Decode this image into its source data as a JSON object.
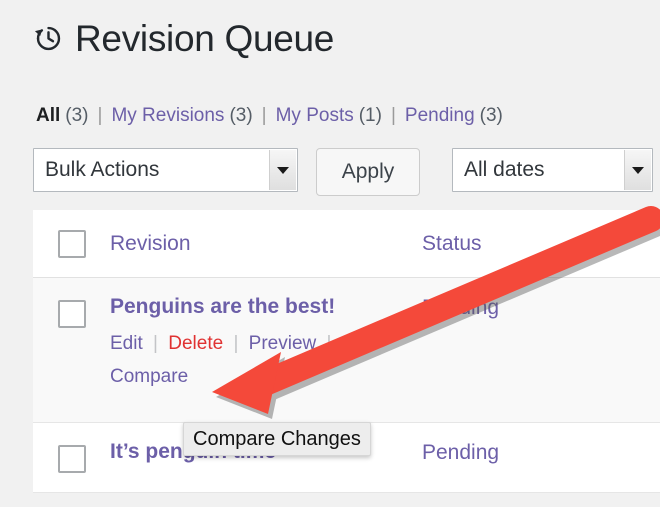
{
  "header": {
    "title": "Revision Queue",
    "icon": "history-clock-icon"
  },
  "filters": {
    "items": [
      {
        "label": "All",
        "count": "(3)",
        "current": true
      },
      {
        "label": "My Revisions",
        "count": "(3)",
        "current": false
      },
      {
        "label": "My Posts",
        "count": "(1)",
        "current": false
      },
      {
        "label": "Pending",
        "count": "(3)",
        "current": false
      }
    ],
    "separator": "|"
  },
  "toolbar": {
    "bulk_actions_value": "Bulk Actions",
    "apply_label": "Apply",
    "date_filter_value": "All dates"
  },
  "table": {
    "columns": {
      "revision": "Revision",
      "status": "Status"
    },
    "rows": [
      {
        "title": "Penguins are the best!",
        "status": "Pending",
        "actions": [
          {
            "label": "Edit",
            "kind": "edit"
          },
          {
            "label": "Delete",
            "kind": "delete"
          },
          {
            "label": "Preview",
            "kind": "preview"
          },
          {
            "label": "Compare",
            "kind": "compare"
          }
        ]
      },
      {
        "title": "It’s penguin time",
        "status": "Pending",
        "actions": []
      }
    ]
  },
  "tooltip": {
    "text": "Compare Changes"
  },
  "annotation": {
    "arrow_color": "#f4493a",
    "arrow_shadow": "#6b6b6b"
  },
  "colors": {
    "link_purple": "#6c5fa8",
    "delete_red": "#e03232",
    "page_background": "#f1f1f1",
    "title_text": "#23282d"
  }
}
